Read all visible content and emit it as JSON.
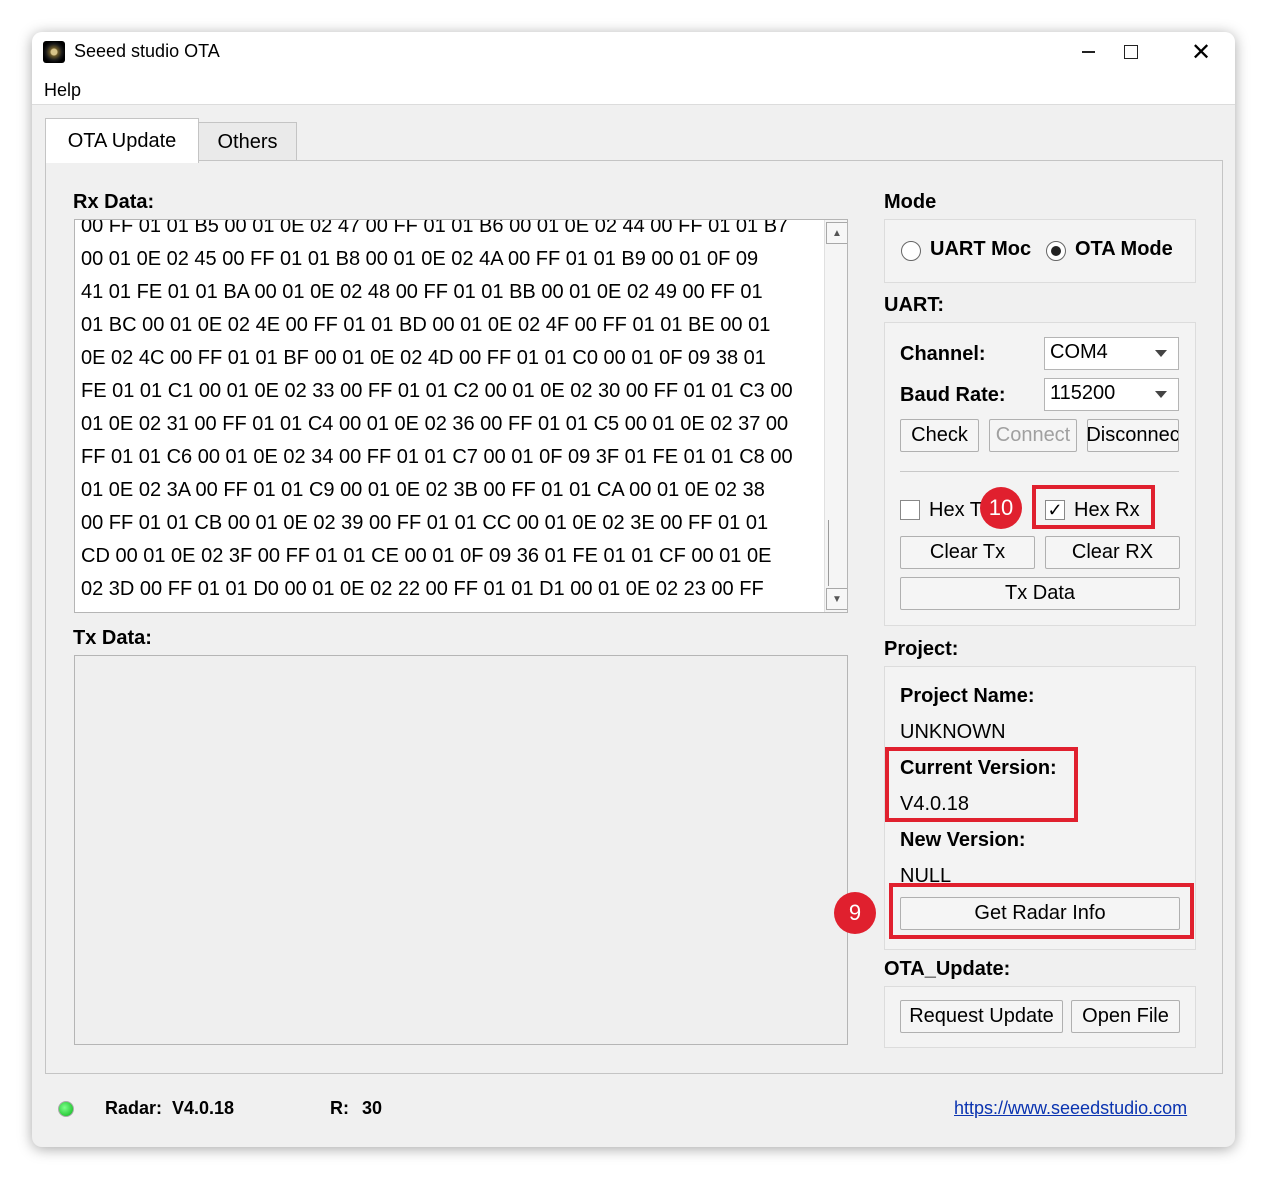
{
  "window": {
    "title": "Seeed studio OTA"
  },
  "menu": {
    "help": "Help"
  },
  "tabs": [
    {
      "label": "OTA Update"
    },
    {
      "label": "Others"
    }
  ],
  "rx": {
    "label": "Rx Data:",
    "lines": [
      "00 FF 01 01 B5 00 01 0E 02 47 00 FF 01 01 B6 00 01 0E 02 44 00 FF 01 01 B7",
      "00 01 0E 02 45 00 FF 01 01 B8 00 01 0E 02 4A 00 FF 01 01 B9 00 01 0F 09",
      "41 01 FE 01 01 BA 00 01 0E 02 48 00 FF 01 01 BB 00 01 0E 02 49 00 FF 01",
      "01 BC 00 01 0E 02 4E 00 FF 01 01 BD 00 01 0E 02 4F 00 FF 01 01 BE 00 01",
      "0E 02 4C 00 FF 01 01 BF 00 01 0E 02 4D 00 FF 01 01 C0 00 01 0F 09 38 01",
      "FE 01 01 C1 00 01 0E 02 33 00 FF 01 01 C2 00 01 0E 02 30 00 FF 01 01 C3 00",
      "01 0E 02 31 00 FF 01 01 C4 00 01 0E 02 36 00 FF 01 01 C5 00 01 0E 02 37 00",
      "FF 01 01 C6 00 01 0E 02 34 00 FF 01 01 C7 00 01 0F 09 3F 01 FE 01 01 C8 00",
      "01 0E 02 3A 00 FF 01 01 C9 00 01 0E 02 3B 00 FF 01 01 CA 00 01 0E 02 38",
      "00 FF 01 01 CB 00 01 0E 02 39 00 FF 01 01 CC 00 01 0E 02 3E 00 FF 01 01",
      "CD 00 01 0E 02 3F 00 FF 01 01 CE 00 01 0F 09 36 01 FE 01 01 CF 00 01 0E",
      "02 3D 00 FF 01 01 D0 00 01 0E 02 22 00 FF 01 01 D1 00 01 0E 02 23 00 FF"
    ]
  },
  "tx": {
    "label": "Tx Data:"
  },
  "mode": {
    "label": "Mode",
    "uart": "UART Moc",
    "ota": "OTA Mode",
    "selected": "OTA Mode"
  },
  "uart": {
    "label": "UART:",
    "channel_label": "Channel:",
    "channel_value": "COM4",
    "baud_label": "Baud Rate:",
    "baud_value": "115200",
    "check": "Check",
    "connect": "Connect",
    "disconnect": "Disconnec",
    "hex_tx": "Hex T",
    "hex_tx_checked": false,
    "hex_rx": "Hex Rx",
    "hex_rx_checked": true,
    "check_mark": "✓",
    "clear_tx": "Clear Tx",
    "clear_rx": "Clear RX",
    "tx_data": "Tx Data"
  },
  "project": {
    "label": "Project:",
    "name_label": "Project Name:",
    "name_value": "UNKNOWN",
    "current_label": "Current Version:",
    "current_value": "V4.0.18",
    "new_label": "New Version:",
    "new_value": "NULL",
    "get_radar_info": "Get Radar Info"
  },
  "ota_update": {
    "label": "OTA_Update:",
    "request": "Request Update",
    "open_file": "Open File"
  },
  "status": {
    "radar_label": "Radar:",
    "radar_value": "V4.0.18",
    "r_label": "R:",
    "r_value": "30",
    "link": "https://www.seeedstudio.com"
  },
  "annotations": [
    {
      "number": "10"
    },
    {
      "number": "9"
    }
  ],
  "colors": {
    "annotation_red": "#e0202e",
    "led_green": "#08b418",
    "link_blue": "#0a33b0"
  }
}
